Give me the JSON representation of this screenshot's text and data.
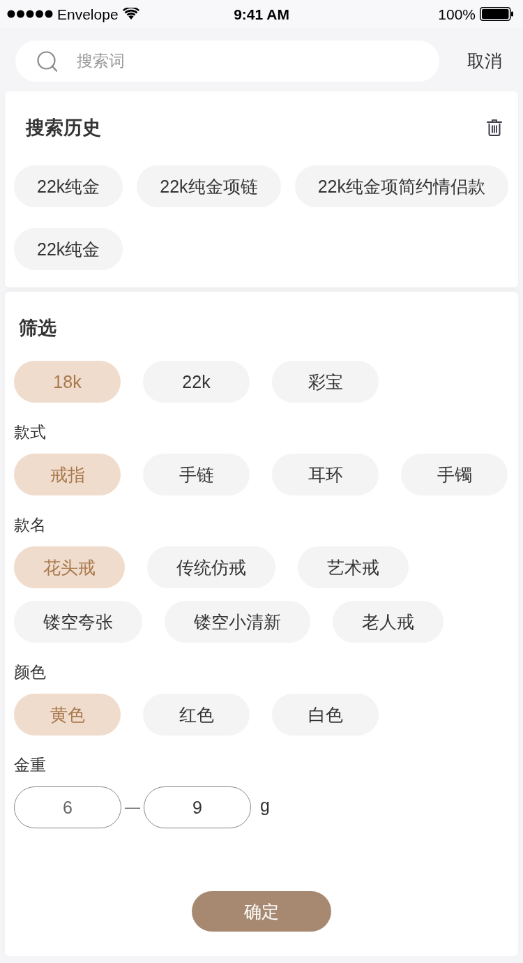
{
  "status_bar": {
    "carrier": "Envelope",
    "time": "9:41 AM",
    "battery": "100%"
  },
  "search": {
    "placeholder": "搜索词",
    "cancel": "取消"
  },
  "history": {
    "title": "搜索历史",
    "items": [
      "22k纯金",
      "22k纯金项链",
      "22k纯金项简约情侣款",
      "22k纯金"
    ]
  },
  "filter": {
    "title": "筛选",
    "groups": [
      {
        "kind": "chips",
        "options": [
          {
            "label": "18k",
            "selected": true
          },
          {
            "label": "22k",
            "selected": false
          },
          {
            "label": "彩宝",
            "selected": false
          }
        ]
      },
      {
        "kind": "chips",
        "label": "款式",
        "options": [
          {
            "label": "戒指",
            "selected": true
          },
          {
            "label": "手链",
            "selected": false
          },
          {
            "label": "耳环",
            "selected": false
          },
          {
            "label": "手镯",
            "selected": false
          }
        ]
      },
      {
        "kind": "chips",
        "label": "款名",
        "options": [
          {
            "label": "花头戒",
            "selected": true
          },
          {
            "label": "传统仿戒",
            "selected": false
          },
          {
            "label": "艺术戒",
            "selected": false
          },
          {
            "label": "镂空夸张",
            "selected": false
          },
          {
            "label": "镂空小清新",
            "selected": false
          },
          {
            "label": "老人戒",
            "selected": false
          }
        ]
      },
      {
        "kind": "chips",
        "label": "颜色",
        "options": [
          {
            "label": "黄色",
            "selected": true
          },
          {
            "label": "红色",
            "selected": false
          },
          {
            "label": "白色",
            "selected": false
          }
        ]
      },
      {
        "kind": "range",
        "label": "金重",
        "min": {
          "placeholder": "6"
        },
        "separator": "—",
        "max": {
          "value": "9"
        },
        "unit": "g"
      }
    ]
  },
  "confirm": "确定"
}
